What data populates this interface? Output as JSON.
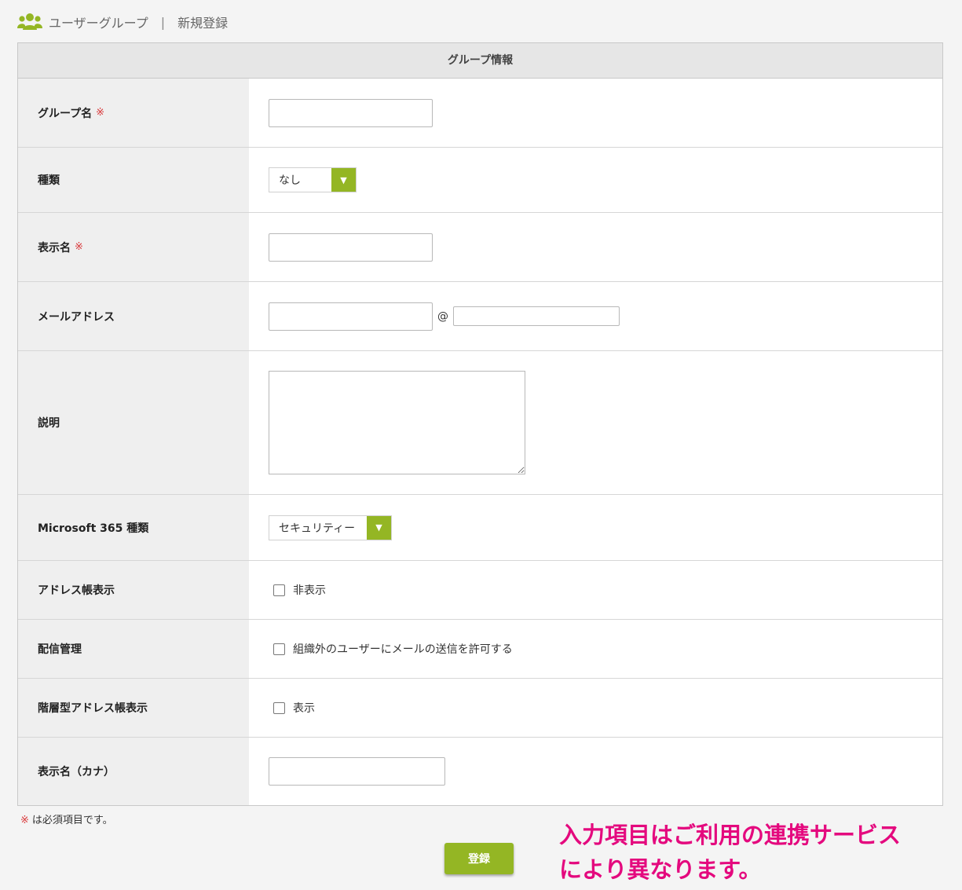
{
  "header": {
    "icon": "users-icon",
    "section": "ユーザーグループ",
    "separator": "|",
    "page": "新規登録"
  },
  "form": {
    "title": "グループ情報",
    "required_mark": "※",
    "rows": {
      "group_name": {
        "label": "グループ名",
        "value": ""
      },
      "type": {
        "label": "種類",
        "selected": "なし"
      },
      "display_name": {
        "label": "表示名",
        "value": ""
      },
      "email": {
        "label": "メールアドレス",
        "local": "",
        "at": "@",
        "domain": ""
      },
      "description": {
        "label": "説明",
        "value": ""
      },
      "ms365_type": {
        "label": "Microsoft 365 種類",
        "selected": "セキュリティー"
      },
      "address_book": {
        "label": "アドレス帳表示",
        "option": "非表示",
        "checked": false
      },
      "delivery": {
        "label": "配信管理",
        "option": "組織外のユーザーにメールの送信を許可する",
        "checked": false
      },
      "hierarchical": {
        "label": "階層型アドレス帳表示",
        "option": "表示",
        "checked": false
      },
      "kana": {
        "label": "表示名（カナ）",
        "value": ""
      }
    }
  },
  "note": {
    "mark": "※",
    "text": "は必須項目です。"
  },
  "submit_label": "登録",
  "annotation": {
    "line1": "入力項目はご利用の連携サービス",
    "line2": "により異なります。"
  },
  "colors": {
    "accent": "#94b624",
    "required": "#d9383a",
    "annotation": "#e4097e"
  }
}
